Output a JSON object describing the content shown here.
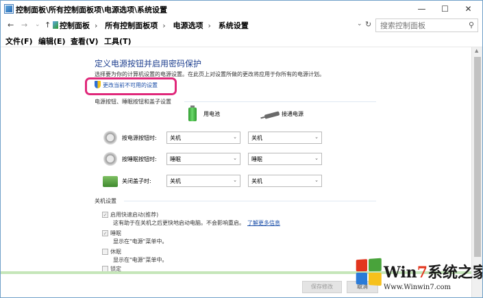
{
  "window": {
    "title": "控制面板\\所有控制面板项\\电源选项\\系统设置",
    "minimize": "—",
    "maximize": "☐",
    "close": "✕"
  },
  "address": {
    "back": "←",
    "forward": "→",
    "recent": "⌄",
    "up": "↑",
    "crumbs": [
      "控制面板",
      "所有控制面板项",
      "电源选项",
      "系统设置"
    ],
    "search_placeholder": "搜索控制面板"
  },
  "menu": [
    "文件(F)",
    "编辑(E)",
    "查看(V)",
    "工具(T)"
  ],
  "page": {
    "heading": "定义电源按钮并启用密码保护",
    "intro": "选择要为你的计算机设置的电源设置。在此页上对设置所做的更改将应用于你所有的电源计划。",
    "change_link": "更改当前不可用的设置",
    "buttons_section": "电源按钮、睡眠按钮和盖子设置",
    "col_battery": "用电池",
    "col_plugged": "接通电源",
    "rows": [
      {
        "label": "按电源按钮时:",
        "battery": "关机",
        "plugged": "关机"
      },
      {
        "label": "按睡眠按钮时:",
        "battery": "睡眠",
        "plugged": "睡眠"
      },
      {
        "label": "关闭盖子时:",
        "battery": "关机",
        "plugged": "关机"
      }
    ],
    "shutdown_section": "关机设置",
    "options": [
      {
        "label": "启用快速启动(推荐)",
        "checked": true,
        "desc": "这有助于在关机之后更快地启动电脑。不会影响重启。",
        "link": "了解更多信息"
      },
      {
        "label": "睡眠",
        "checked": true,
        "desc": "显示在\"电源\"菜单中。"
      },
      {
        "label": "休眠",
        "checked": false,
        "desc": "显示在\"电源\"菜单中。"
      },
      {
        "label": "锁定",
        "checked": false
      }
    ],
    "save_button": "保存修改",
    "cancel_button": "取消"
  },
  "watermark": {
    "brand_prefix": "Win",
    "brand_seven": "7",
    "brand_suffix": "系统之家",
    "url": "Www.Winwin7.com"
  },
  "colors": {
    "highlight": "#e0287a",
    "link": "#1a4ea8",
    "heading": "#1e3f8f"
  }
}
